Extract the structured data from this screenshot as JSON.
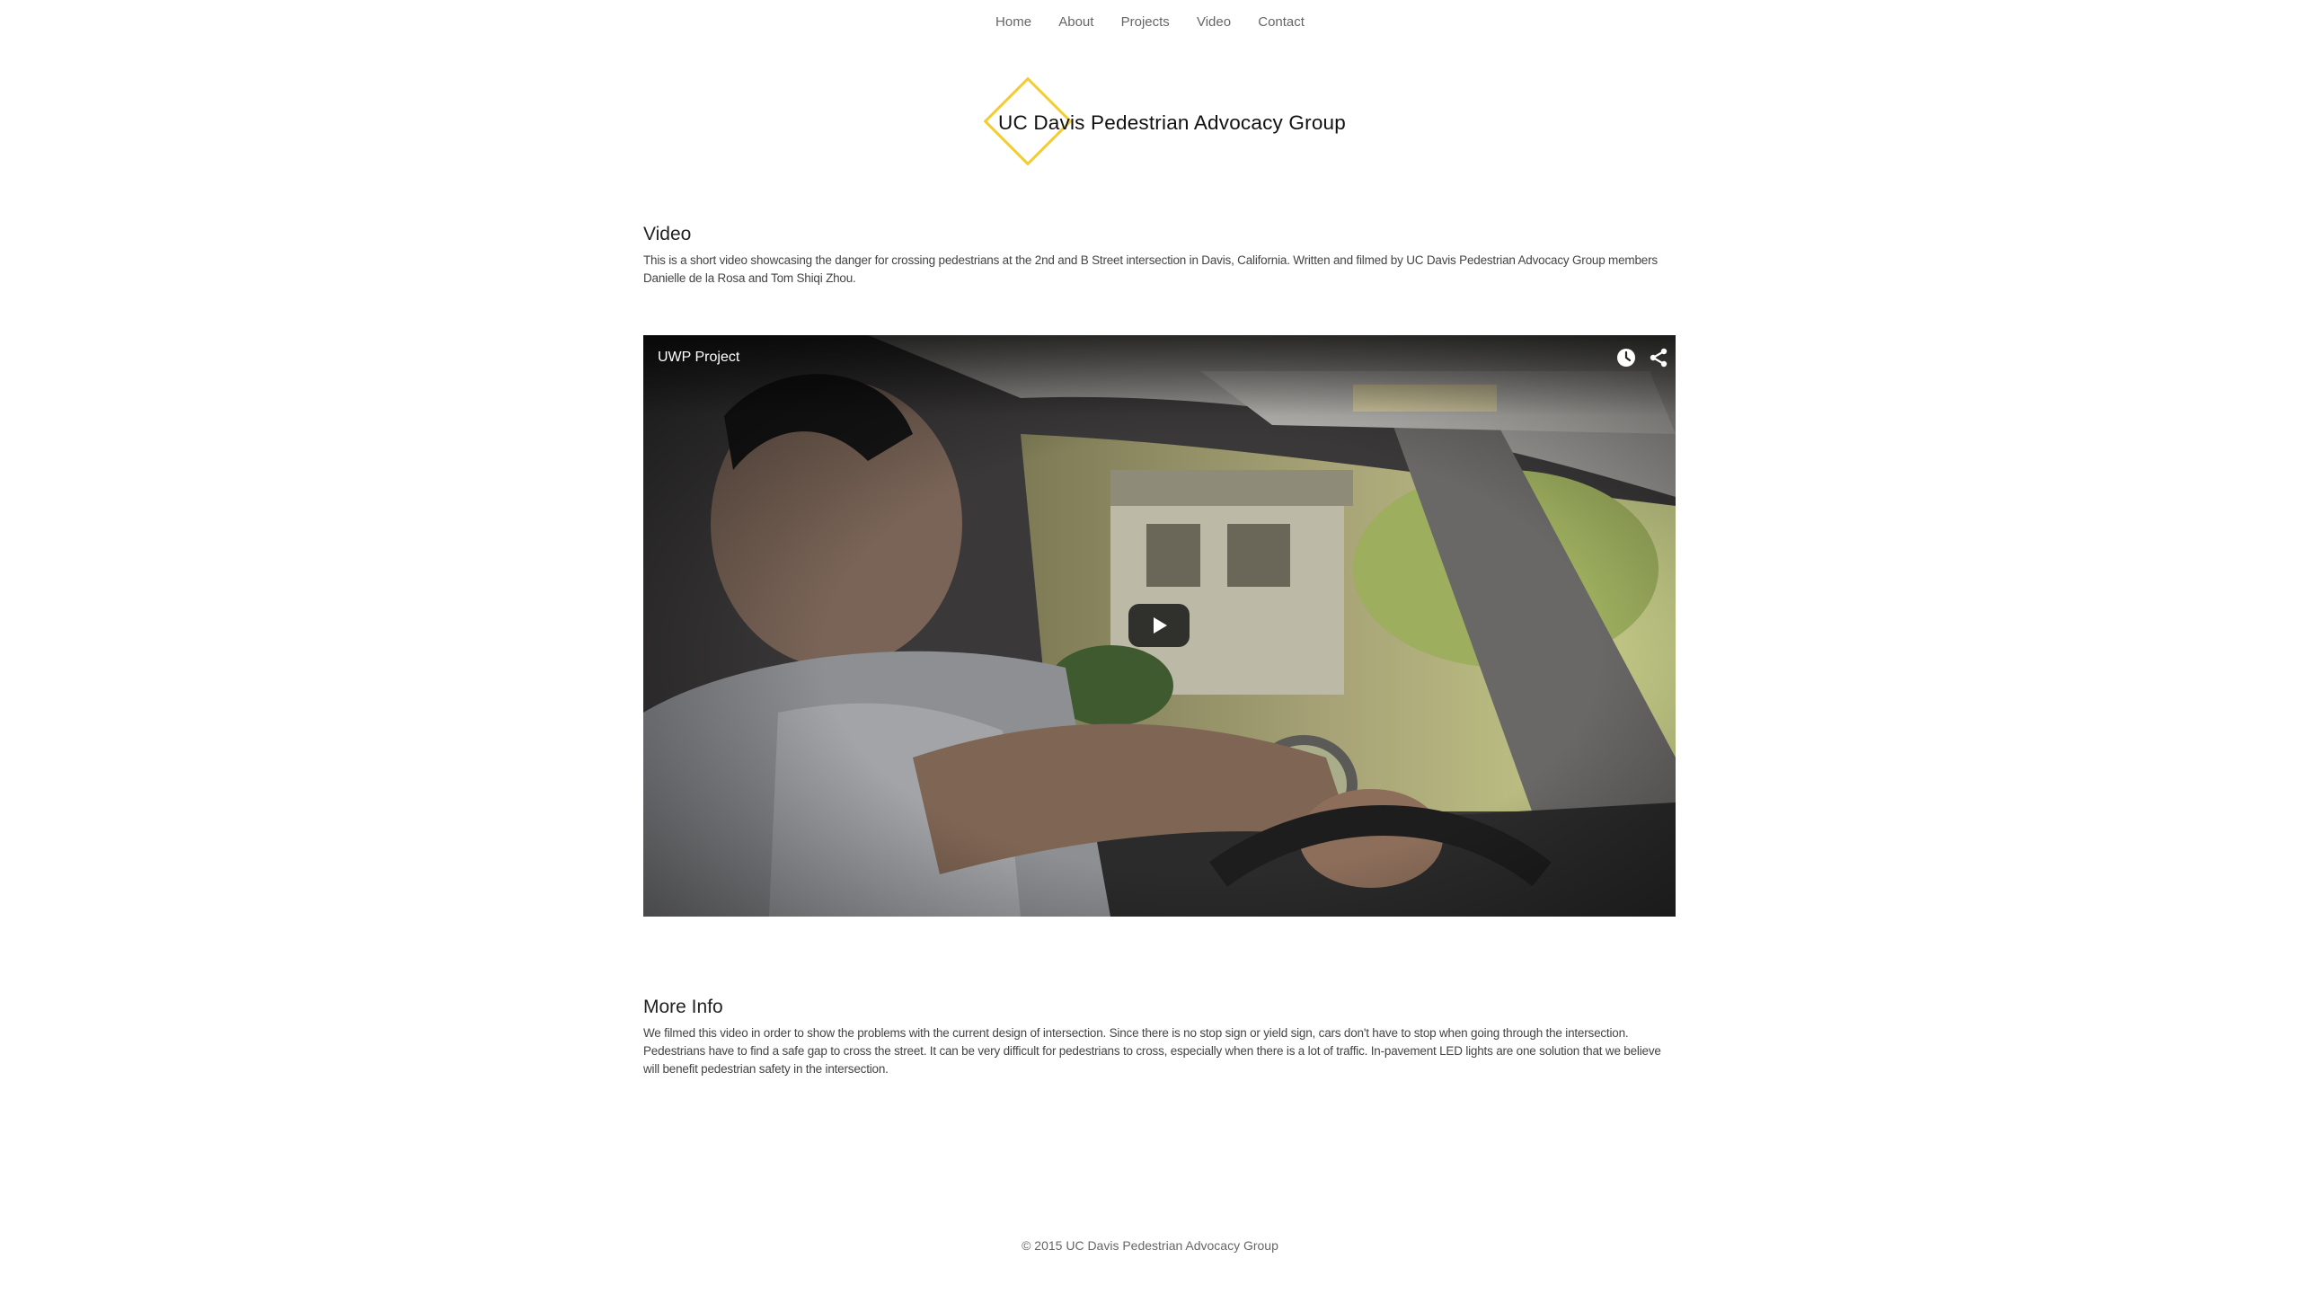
{
  "nav": {
    "items": [
      {
        "label": "Home"
      },
      {
        "label": "About"
      },
      {
        "label": "Projects"
      },
      {
        "label": "Video"
      },
      {
        "label": "Contact"
      }
    ]
  },
  "logo": {
    "text": "UC Davis Pedestrian Advocacy Group",
    "accent_color": "#f3cd2f"
  },
  "video_section": {
    "heading": "Video",
    "description": "This is a short video showcasing the danger for crossing pedestrians at the 2nd and B Street intersection in Davis, California. Written and filmed by UC Davis Pedestrian Advocacy Group members Danielle de la Rosa and Tom Shiqi Zhou."
  },
  "player": {
    "title": "UWP Project",
    "icons": [
      "clock-icon",
      "share-icon",
      "play-icon"
    ]
  },
  "info_section": {
    "heading": "More Info",
    "description": "We filmed this video in order to show the problems with the current design of intersection. Since there is no stop sign or yield sign, cars don't have to stop when going through the intersection. Pedestrians have to find a safe gap to cross the street. It can be very difficult for pedestrians to cross, especially when there is a lot of traffic. In-pavement LED lights are one solution that we believe will benefit pedestrian safety in the intersection."
  },
  "footer": {
    "text": "© 2015 UC Davis Pedestrian Advocacy Group"
  }
}
